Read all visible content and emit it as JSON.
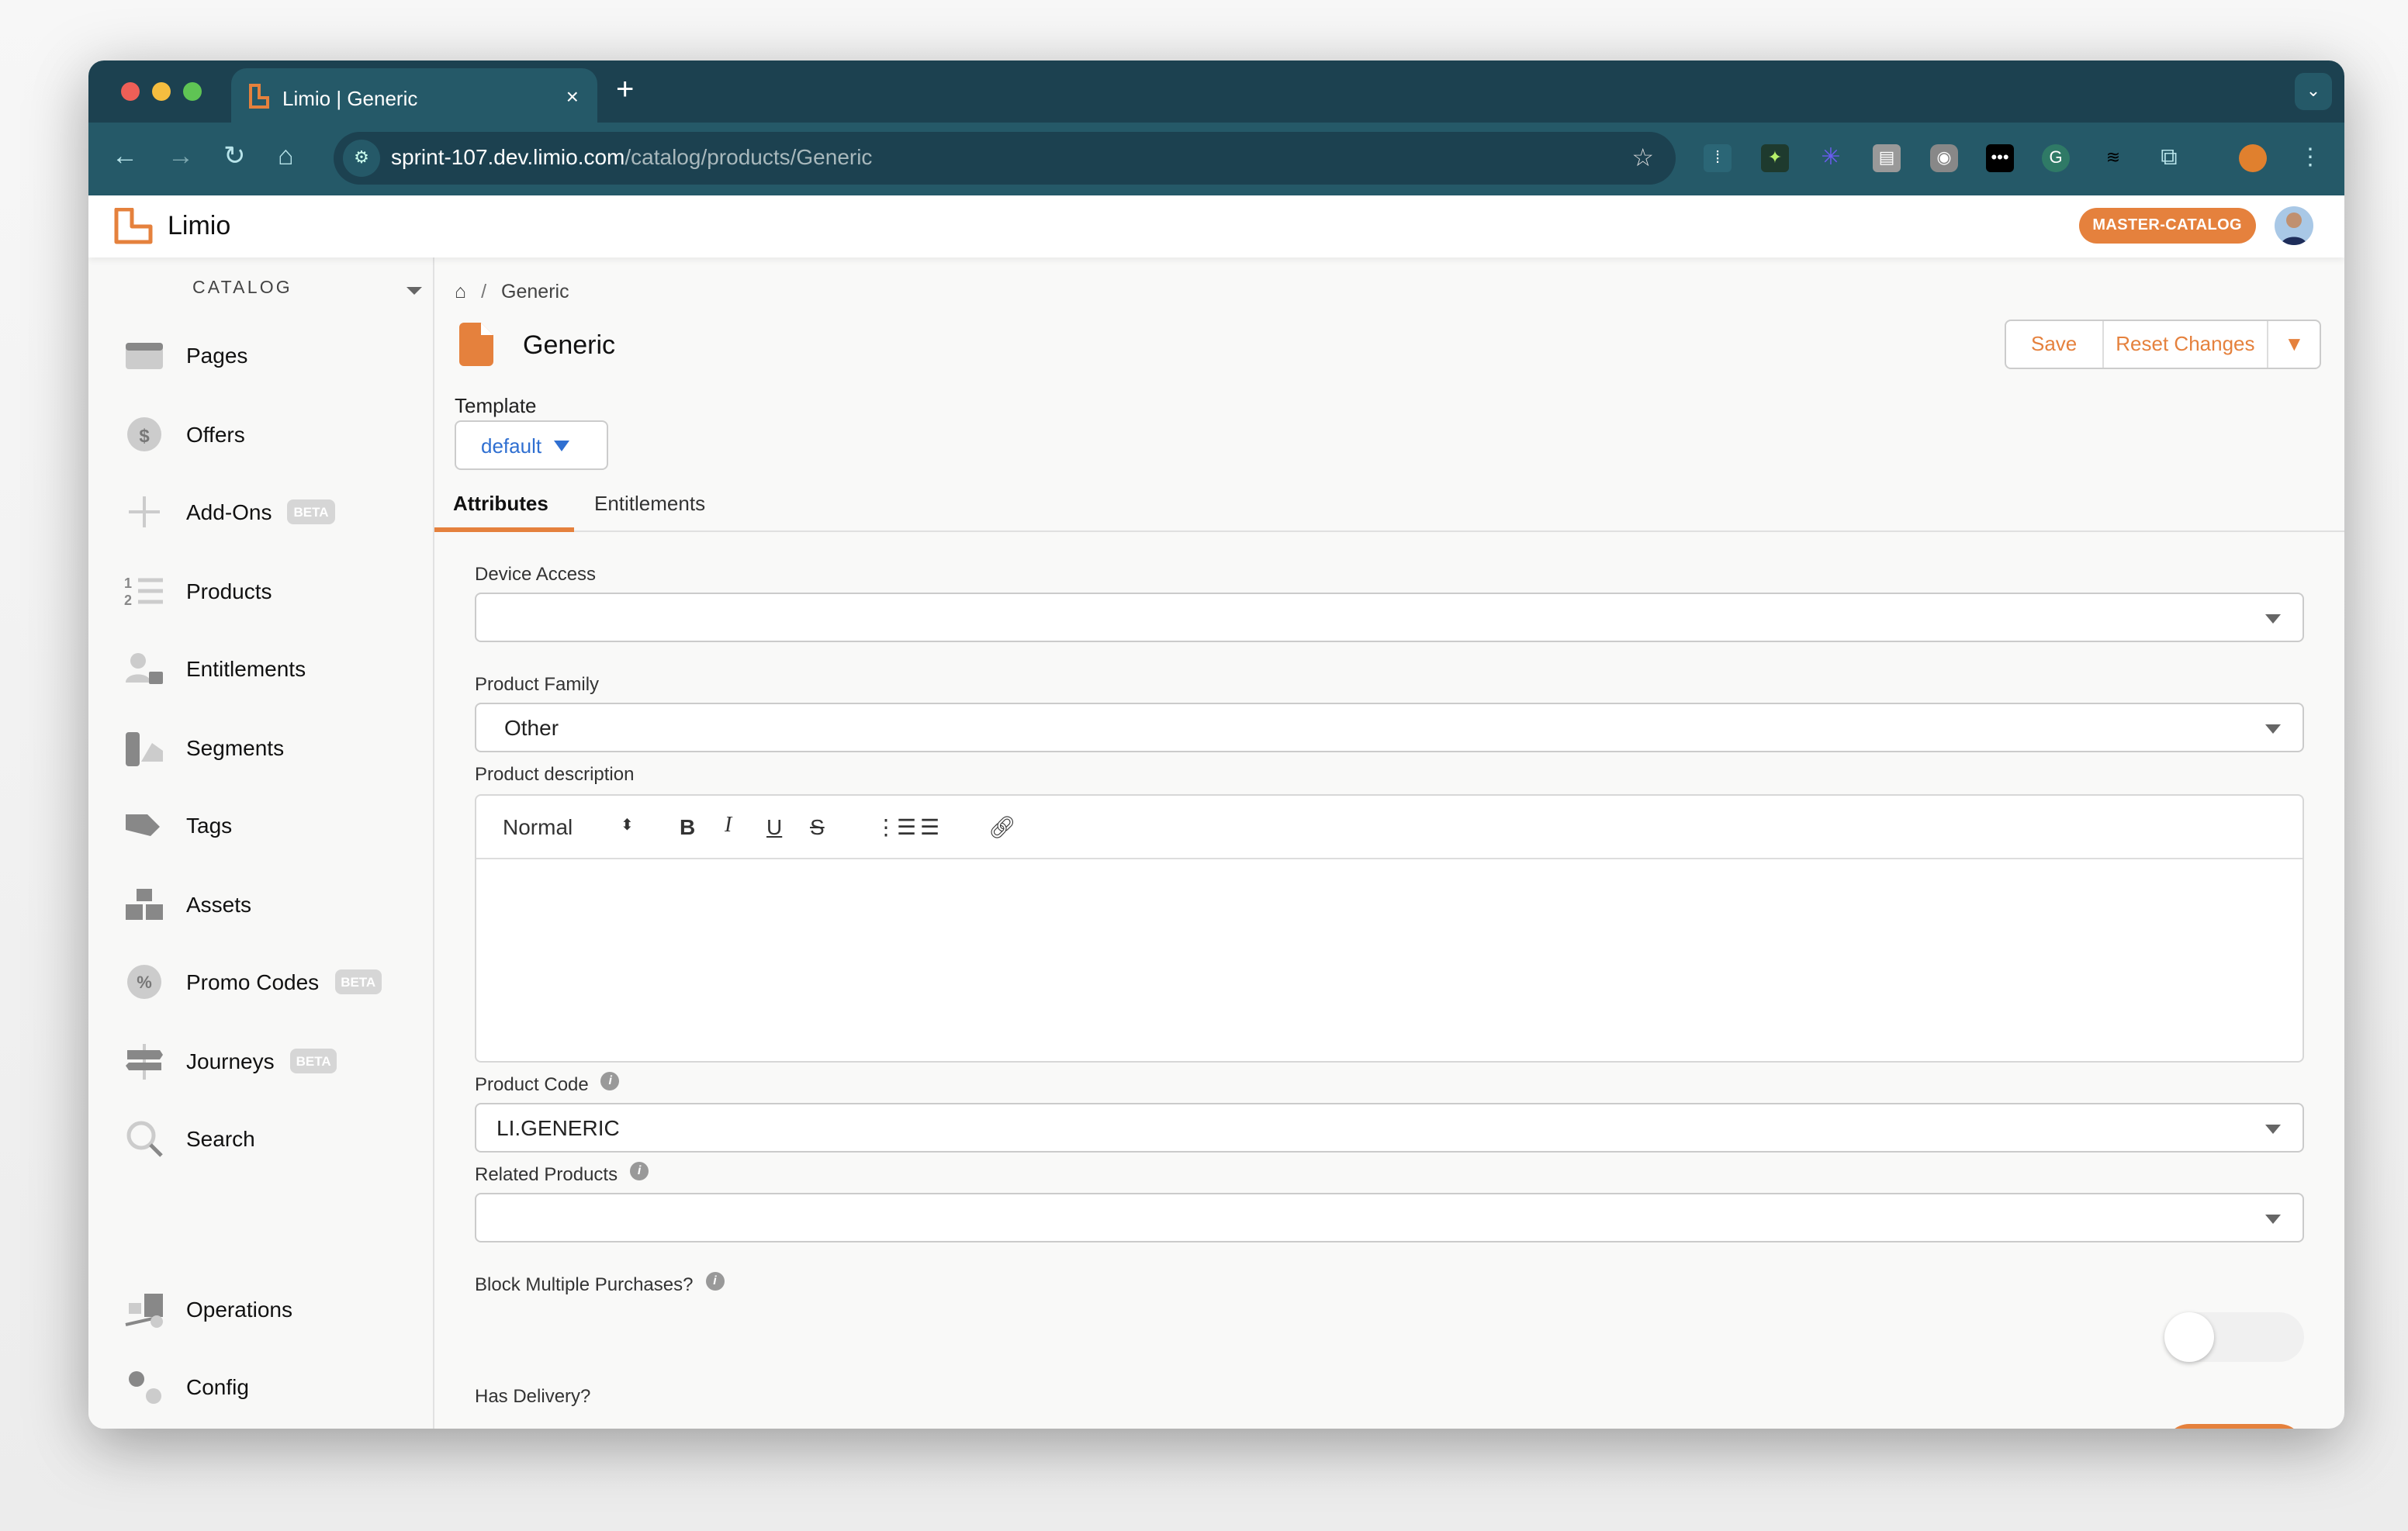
{
  "browser": {
    "tab_title": "Limio | Generic",
    "tab_close": "×",
    "new_tab": "+",
    "url_host": "sprint-107.dev.limio.com",
    "url_path": "/catalog/products/Generic"
  },
  "app": {
    "brand": "Limio",
    "catalog_badge": "MASTER-CATALOG",
    "accent_color": "#e5813d"
  },
  "sidebar": {
    "section": "CATALOG",
    "items": [
      {
        "label": "Pages",
        "icon": "pages-icon"
      },
      {
        "label": "Offers",
        "icon": "offers-icon"
      },
      {
        "label": "Add-Ons",
        "icon": "plus-icon",
        "badge": "BETA"
      },
      {
        "label": "Products",
        "icon": "numbered-list-icon"
      },
      {
        "label": "Entitlements",
        "icon": "user-lock-icon"
      },
      {
        "label": "Segments",
        "icon": "segments-icon"
      },
      {
        "label": "Tags",
        "icon": "tags-icon"
      },
      {
        "label": "Assets",
        "icon": "boxes-icon"
      },
      {
        "label": "Promo Codes",
        "icon": "percent-badge-icon",
        "badge": "BETA"
      },
      {
        "label": "Journeys",
        "icon": "signpost-icon",
        "badge": "BETA"
      },
      {
        "label": "Search",
        "icon": "search-icon"
      },
      {
        "label": "Operations",
        "icon": "dolly-icon"
      },
      {
        "label": "Config",
        "icon": "gears-icon"
      }
    ]
  },
  "main": {
    "breadcrumb_sep": "/",
    "breadcrumb_current": "Generic",
    "title": "Generic",
    "save_label": "Save",
    "reset_label": "Reset Changes",
    "template_label": "Template",
    "template_value": "default",
    "tabs": [
      "Attributes",
      "Entitlements"
    ],
    "fields": {
      "device_access_label": "Device Access",
      "device_access_value": "",
      "product_family_label": "Product Family",
      "product_family_value": "Other",
      "description_label": "Product description",
      "editor_format": "Normal",
      "product_code_label": "Product Code",
      "product_code_value": "LI.GENERIC",
      "related_products_label": "Related Products",
      "block_multiple_label": "Block Multiple Purchases?",
      "block_multiple_on": false,
      "has_delivery_label": "Has Delivery?",
      "has_delivery_on": true
    }
  }
}
